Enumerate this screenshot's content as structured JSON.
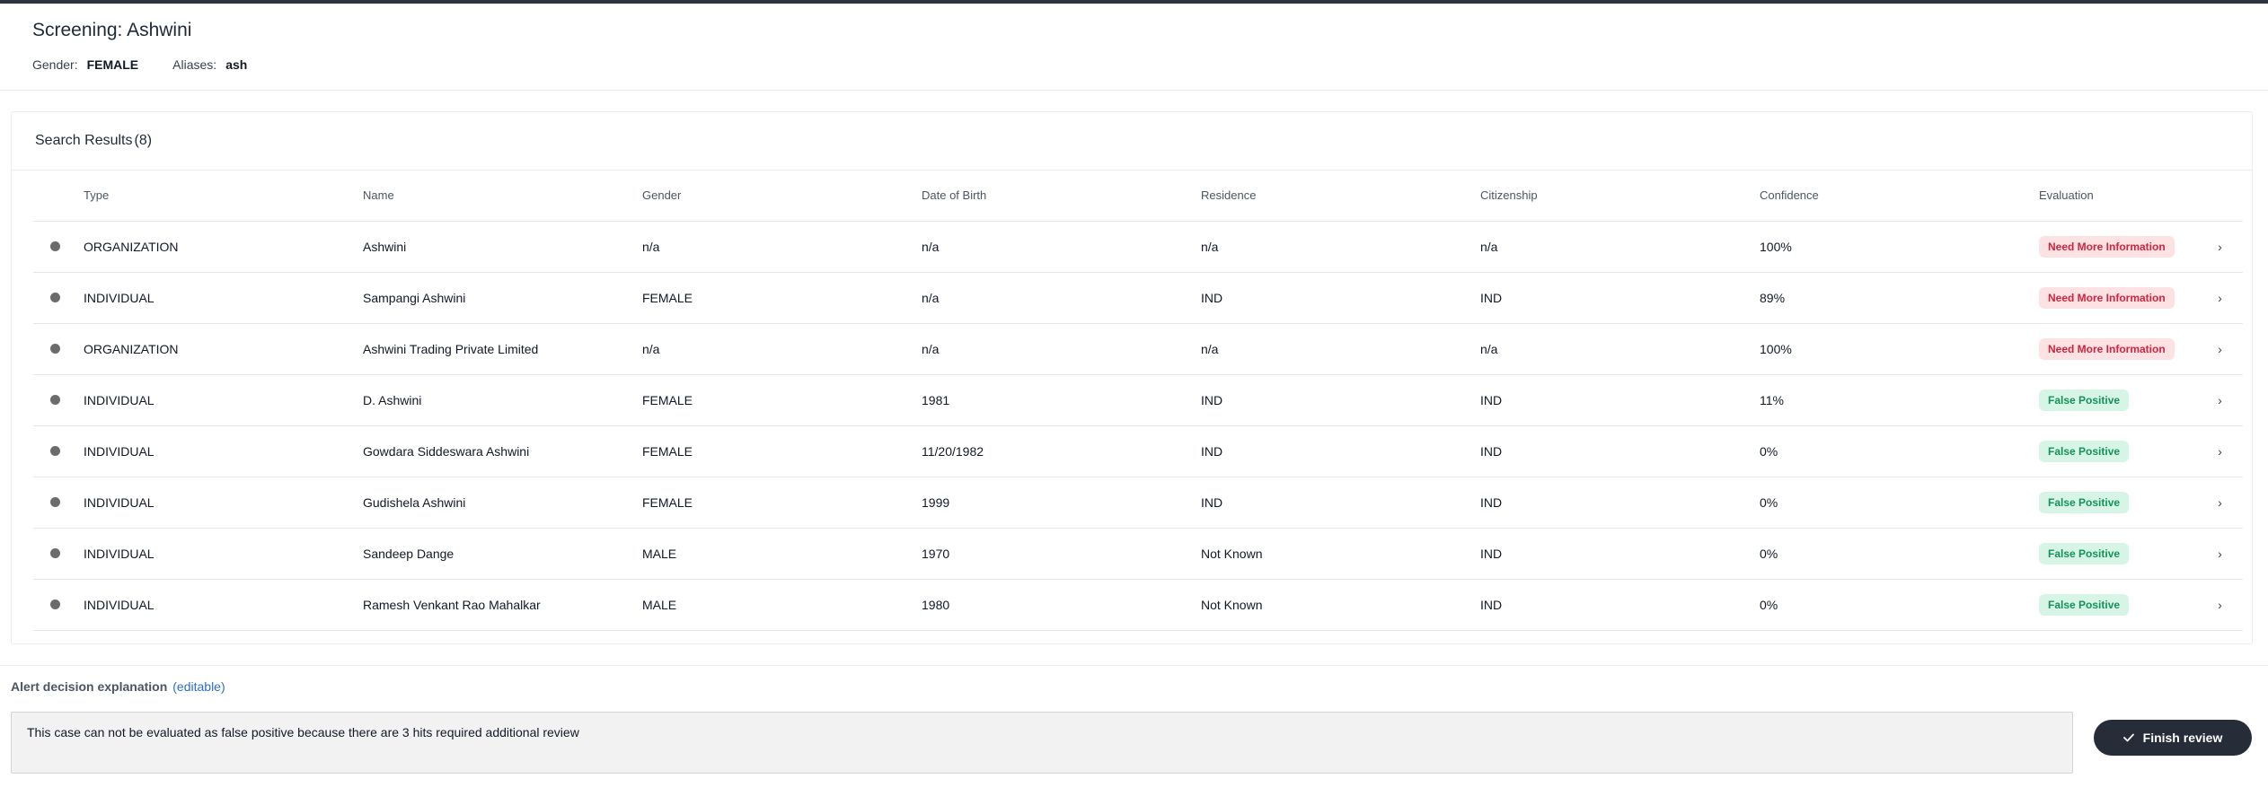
{
  "header": {
    "title": "Screening: Ashwini",
    "gender_label": "Gender:",
    "gender_value": "FEMALE",
    "aliases_label": "Aliases:",
    "aliases_value": "ash"
  },
  "results": {
    "title": "Search Results",
    "count": "(8)",
    "columns": [
      "Type",
      "Name",
      "Gender",
      "Date of Birth",
      "Residence",
      "Citizenship",
      "Confidence",
      "Evaluation"
    ],
    "rows": [
      {
        "type": "ORGANIZATION",
        "name": "Ashwini",
        "gender": "n/a",
        "dob": "n/a",
        "residence": "n/a",
        "citizenship": "n/a",
        "confidence": "100%",
        "evaluation": "Need More Information",
        "status": "need"
      },
      {
        "type": "INDIVIDUAL",
        "name": "Sampangi Ashwini",
        "gender": "FEMALE",
        "dob": "n/a",
        "residence": "IND",
        "citizenship": "IND",
        "confidence": "89%",
        "evaluation": "Need More Information",
        "status": "need"
      },
      {
        "type": "ORGANIZATION",
        "name": "Ashwini Trading Private Limited",
        "gender": "n/a",
        "dob": "n/a",
        "residence": "n/a",
        "citizenship": "n/a",
        "confidence": "100%",
        "evaluation": "Need More Information",
        "status": "need"
      },
      {
        "type": "INDIVIDUAL",
        "name": "D. Ashwini",
        "gender": "FEMALE",
        "dob": "1981",
        "residence": "IND",
        "citizenship": "IND",
        "confidence": "11%",
        "evaluation": "False Positive",
        "status": "fp"
      },
      {
        "type": "INDIVIDUAL",
        "name": "Gowdara Siddeswara Ashwini",
        "gender": "FEMALE",
        "dob": "11/20/1982",
        "residence": "IND",
        "citizenship": "IND",
        "confidence": "0%",
        "evaluation": "False Positive",
        "status": "fp"
      },
      {
        "type": "INDIVIDUAL",
        "name": "Gudishela Ashwini",
        "gender": "FEMALE",
        "dob": "1999",
        "residence": "IND",
        "citizenship": "IND",
        "confidence": "0%",
        "evaluation": "False Positive",
        "status": "fp"
      },
      {
        "type": "INDIVIDUAL",
        "name": "Sandeep Dange",
        "gender": "MALE",
        "dob": "1970",
        "residence": "Not Known",
        "citizenship": "IND",
        "confidence": "0%",
        "evaluation": "False Positive",
        "status": "fp"
      },
      {
        "type": "INDIVIDUAL",
        "name": "Ramesh Venkant Rao Mahalkar",
        "gender": "MALE",
        "dob": "1980",
        "residence": "Not Known",
        "citizenship": "IND",
        "confidence": "0%",
        "evaluation": "False Positive",
        "status": "fp"
      }
    ]
  },
  "explanation": {
    "label": "Alert decision explanation",
    "editable": "(editable)",
    "text": "This case can not be evaluated as false positive because there are 3 hits required additional review"
  },
  "actions": {
    "finish_label": "Finish review"
  },
  "colors": {
    "need_bg": "#fde2e4",
    "need_fg": "#d1243e",
    "fp_bg": "#d6f5e6",
    "fp_fg": "#15925a",
    "button_bg": "#262c38"
  }
}
